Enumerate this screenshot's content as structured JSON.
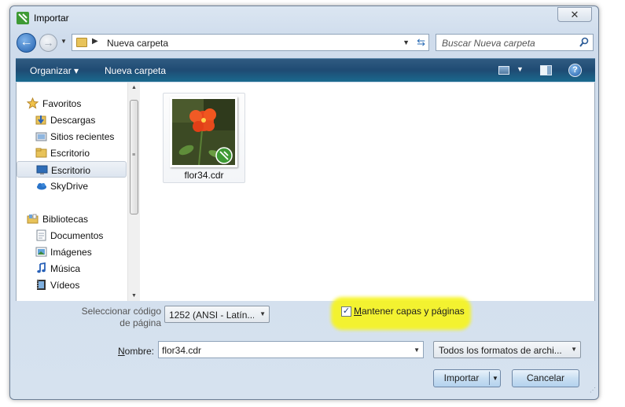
{
  "window": {
    "title": "Importar",
    "close_symbol": "✕"
  },
  "nav": {
    "back_symbol": "←",
    "forward_symbol": "→",
    "history_symbol": "▼",
    "breadcrumb_arrow": "▶",
    "breadcrumb": "Nueva carpeta",
    "address_dropdown": "▼",
    "refresh_symbol": "⇆"
  },
  "search": {
    "placeholder": "Buscar Nueva carpeta"
  },
  "toolbar": {
    "organize_label": "Organizar ▾",
    "new_folder_label": "Nueva carpeta",
    "view_dropdown": "▼",
    "help_symbol": "?"
  },
  "sidebar": {
    "items": [
      {
        "label": "Favoritos",
        "icon": "star-icon"
      },
      {
        "label": "Descargas",
        "icon": "downloads-icon"
      },
      {
        "label": "Sitios recientes",
        "icon": "recent-places-icon"
      },
      {
        "label": "Escritorio",
        "icon": "folder-icon"
      },
      {
        "label": "Escritorio",
        "icon": "desktop-icon",
        "selected": true
      },
      {
        "label": "SkyDrive",
        "icon": "cloud-icon"
      },
      {
        "label": "Bibliotecas",
        "icon": "libraries-icon"
      },
      {
        "label": "Documentos",
        "icon": "documents-icon"
      },
      {
        "label": "Imágenes",
        "icon": "pictures-icon"
      },
      {
        "label": "Música",
        "icon": "music-icon"
      },
      {
        "label": "Vídeos",
        "icon": "videos-icon"
      }
    ],
    "scroll_up": "▲",
    "scroll_down": "▼",
    "scroll_grip": "≡"
  },
  "files": [
    {
      "name": "flor34.cdr",
      "icon": "cdr-file-thumbnail"
    }
  ],
  "encoding": {
    "label_line1": "Seleccionar código",
    "label_line2": "de página",
    "value": "1252  (ANSI - Latín...",
    "arrow": "▼"
  },
  "options": {
    "keep_layers_checked": true,
    "check_symbol": "✓",
    "keep_layers_label_u": "M",
    "keep_layers_label_rest": "antener capas y páginas",
    "highlight_color": "#f6f420"
  },
  "filename": {
    "label_u": "N",
    "label_rest": "ombre:",
    "value": "flor34.cdr",
    "arrow": "▼"
  },
  "filter": {
    "value": "Todos los formatos de archi...",
    "arrow": "▼"
  },
  "buttons": {
    "import": "Importar",
    "import_arrow": "▼",
    "cancel": "Cancelar"
  },
  "colors": {
    "toolbar": "#1f4b73",
    "accent": "#3e9a35"
  }
}
